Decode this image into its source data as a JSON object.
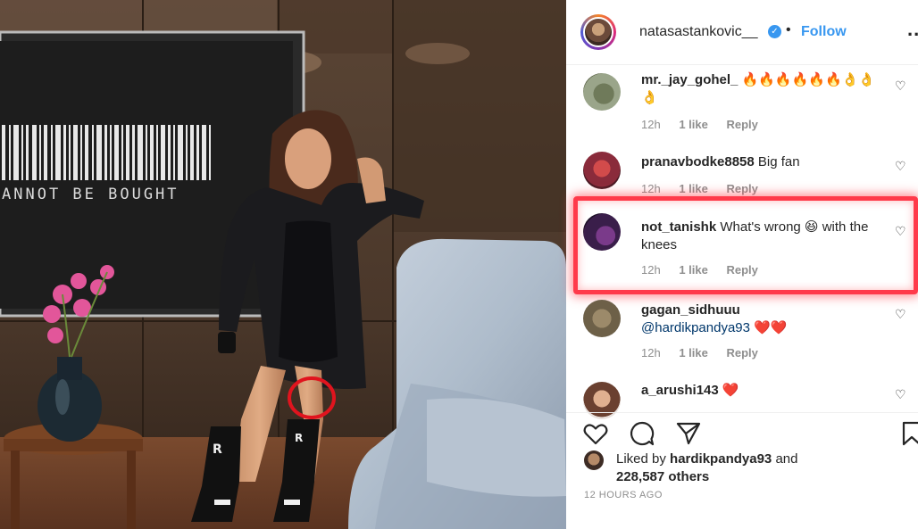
{
  "post": {
    "photo_text": "ANNOT BE BOUGHT"
  },
  "header": {
    "username": "natasastankovic__",
    "verified": true,
    "separator": "•",
    "follow_label": "Follow",
    "more_label": "..."
  },
  "comments": [
    {
      "user": "mr._jay_gohel_",
      "text": "🔥🔥🔥🔥🔥🔥👌👌👌",
      "time": "12h",
      "likes": "1 like",
      "reply": "Reply"
    },
    {
      "user": "pranavbodke8858",
      "text": "Big fan",
      "time": "12h",
      "likes": "1 like",
      "reply": "Reply"
    },
    {
      "user": "not_tanishk",
      "text": "What's wrong 😆 with the knees",
      "time": "12h",
      "likes": "1 like",
      "reply": "Reply"
    },
    {
      "user": "gagan_sidhuuu",
      "mention": "@hardikpandya93",
      "text": "❤️❤️",
      "time": "12h",
      "likes": "1 like",
      "reply": "Reply"
    },
    {
      "user": "a_arushi143",
      "text": "❤️"
    }
  ],
  "actions": {
    "like_icon": "heart-icon",
    "comment_icon": "comment-icon",
    "share_icon": "share-icon",
    "save_icon": "bookmark-icon"
  },
  "likes_summary": {
    "prefix": "Liked by",
    "user": "hardikpandya93",
    "and": "and",
    "others": "228,587 others"
  },
  "time_ago": "12 HOURS AGO",
  "colors": {
    "accent": "#3897f0",
    "highlight": "#ff3a4a",
    "annotation_circle": "#e0141e"
  }
}
